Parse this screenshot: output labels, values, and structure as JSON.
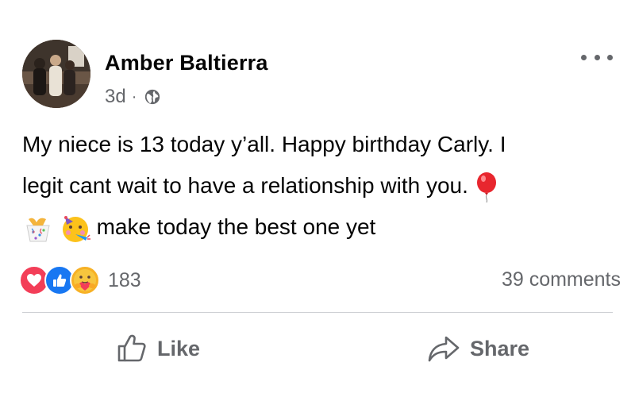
{
  "post": {
    "author": "Amber Baltierra",
    "time": "3d",
    "separator": "·",
    "privacy_icon": "globe-icon",
    "text_line1": "My niece is 13 today y’all. Happy birthday Carly. I",
    "text_line2": "legit cant wait to have a relationship with you.",
    "text_line3": "make today the best one yet",
    "emojis": [
      "balloon",
      "confetti-ball",
      "partying-face"
    ]
  },
  "reactions": {
    "icons": [
      "love-reaction-icon",
      "like-reaction-icon",
      "care-reaction-icon"
    ],
    "count": "183",
    "colors": {
      "love": "#f33e58",
      "like": "#1877f2",
      "care": "#f7b125"
    }
  },
  "comments_label": "39 comments",
  "actions": {
    "like_label": "Like",
    "share_label": "Share"
  },
  "colors": {
    "text": "#050505",
    "secondary": "#65676b",
    "divider": "#ced0d4"
  }
}
